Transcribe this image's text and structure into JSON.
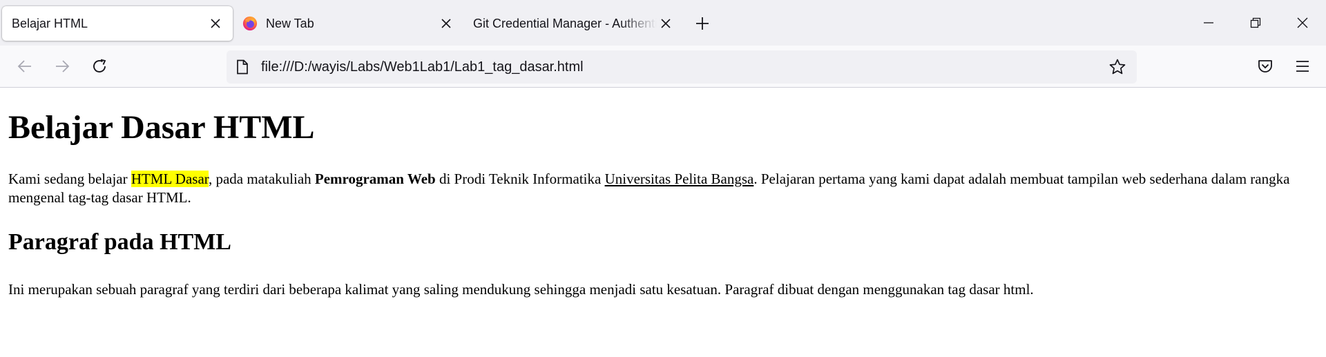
{
  "browser": {
    "tabs": [
      {
        "title": "Belajar HTML",
        "active": true,
        "favicon": "none"
      },
      {
        "title": "New Tab",
        "active": false,
        "favicon": "firefox-logo-icon"
      },
      {
        "title": "Git Credential Manager - Authentication",
        "active": false,
        "favicon": "none"
      }
    ],
    "url": "file:///D:/wayis/Labs/Web1Lab1/Lab1_tag_dasar.html"
  },
  "page": {
    "heading": "Belajar Dasar HTML",
    "para1": {
      "t1": "Kami sedang belajar ",
      "highlight": "HTML Dasar",
      "t2": ", pada matakuliah ",
      "bold": "Pemrograman Web",
      "t3": " di Prodi Teknik Informatika ",
      "underline": "Universitas Pelita Bangsa",
      "t4": ". Pelajaran pertama yang kami dapat adalah membuat tampilan web sederhana dalam rangka mengenal tag-tag dasar HTML."
    },
    "subheading": "Paragraf pada HTML",
    "para2": "Ini merupakan sebuah paragraf yang terdiri dari beberapa kalimat yang saling mendukung sehingga menjadi satu kesatuan. Paragraf dibuat dengan menggunakan tag dasar html."
  },
  "colors": {
    "highlight": "#ffff00",
    "chrome_bg": "#f0f0f4",
    "toolbar_bg": "#f9f9fb"
  }
}
